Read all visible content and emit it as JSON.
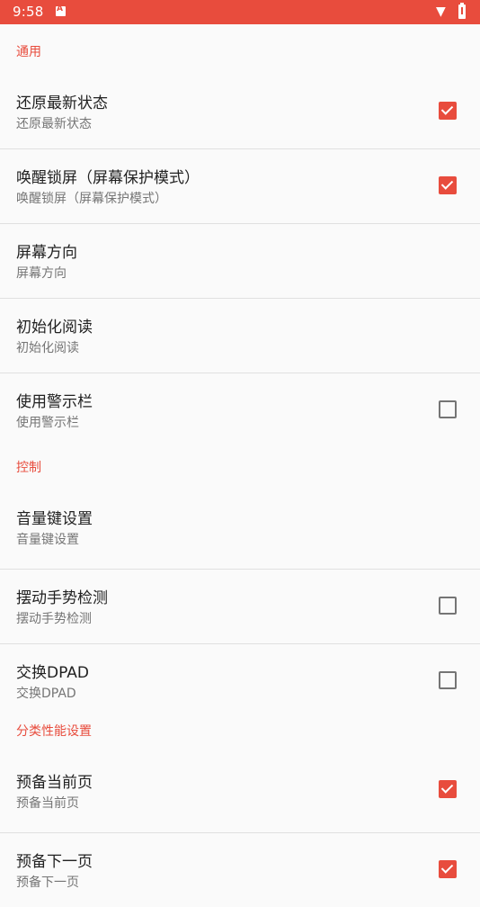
{
  "status_bar": {
    "time": "9:58",
    "icons": [
      "notification-a-icon",
      "wifi-icon",
      "battery-icon"
    ]
  },
  "accent_color": "#e84c3d",
  "sections": [
    {
      "header": "通用",
      "items": [
        {
          "title": "还原最新状态",
          "summary": "还原最新状态",
          "checkbox": true,
          "checked": true
        },
        {
          "title": "唤醒锁屏（屏幕保护模式）",
          "summary": "唤醒锁屏（屏幕保护模式）",
          "checkbox": true,
          "checked": true
        },
        {
          "title": "屏幕方向",
          "summary": "屏幕方向",
          "checkbox": false
        },
        {
          "title": "初始化阅读",
          "summary": "初始化阅读",
          "checkbox": false
        },
        {
          "title": "使用警示栏",
          "summary": "使用警示栏",
          "checkbox": true,
          "checked": false
        }
      ]
    },
    {
      "header": "控制",
      "items": [
        {
          "title": "音量键设置",
          "summary": "音量键设置",
          "checkbox": false
        },
        {
          "title": "摆动手势检测",
          "summary": "摆动手势检测",
          "checkbox": true,
          "checked": false
        },
        {
          "title": "交换DPAD",
          "summary": "交换DPAD",
          "checkbox": true,
          "checked": false
        }
      ]
    },
    {
      "header": "分类性能设置",
      "items": [
        {
          "title": "预备当前页",
          "summary": "预备当前页",
          "checkbox": true,
          "checked": true
        },
        {
          "title": "预备下一页",
          "summary": "预备下一页",
          "checkbox": true,
          "checked": true
        }
      ]
    }
  ]
}
